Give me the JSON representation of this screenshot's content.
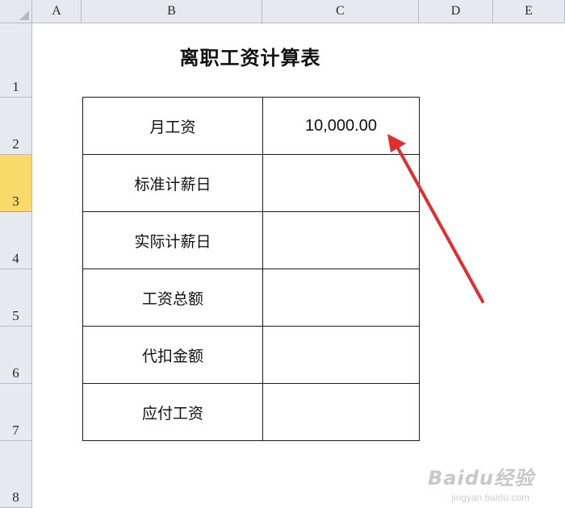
{
  "columns": [
    "A",
    "B",
    "C",
    "D",
    "E"
  ],
  "rows": [
    "1",
    "2",
    "3",
    "4",
    "5",
    "6",
    "7",
    "8"
  ],
  "selected_row": "3",
  "title": "离职工资计算表",
  "table": [
    {
      "label": "月工资",
      "value": "10,000.00"
    },
    {
      "label": "标准计薪日",
      "value": ""
    },
    {
      "label": "实际计薪日",
      "value": ""
    },
    {
      "label": "工资总额",
      "value": ""
    },
    {
      "label": "代扣金额",
      "value": ""
    },
    {
      "label": "应付工资",
      "value": ""
    }
  ],
  "annotation_color": "#e02f2f",
  "watermark": {
    "brand": "Baidu经验",
    "url": "jingyan.baidu.com"
  }
}
